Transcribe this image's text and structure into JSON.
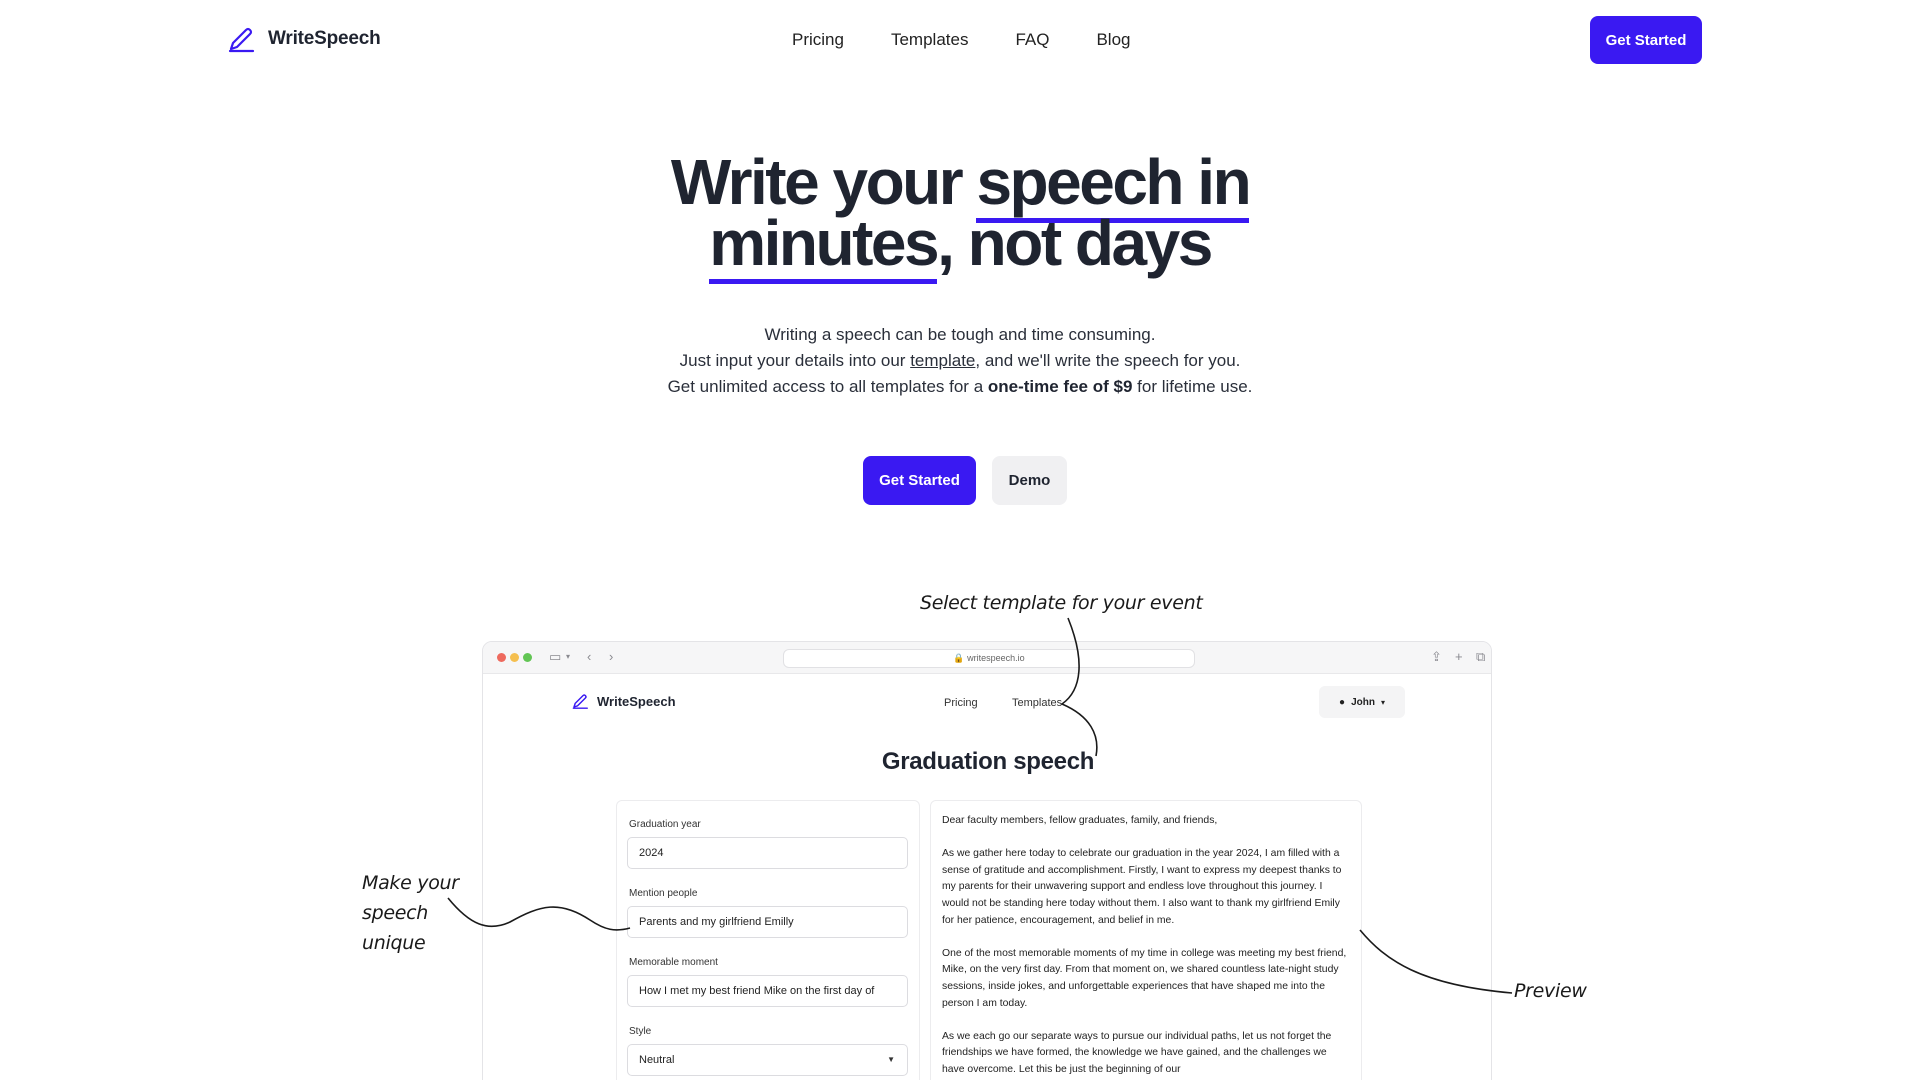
{
  "brand": {
    "name": "WriteSpeech"
  },
  "nav": {
    "links": [
      "Pricing",
      "Templates",
      "FAQ",
      "Blog"
    ],
    "cta": "Get Started"
  },
  "hero": {
    "title_part1": "Write your ",
    "title_highlight1": "speech in",
    "title_highlight2": "minutes",
    "title_part2": ", not days",
    "line1": "Writing a speech can be tough and time consuming.",
    "line2_pre": "Just input your details into our ",
    "line2_link": "template",
    "line2_post": ", and we'll write the speech for you.",
    "line3_pre": "Get unlimited access to all templates for a ",
    "line3_bold": "one-time fee of $9",
    "line3_post": " for lifetime use.",
    "cta": "Get Started",
    "demo": "Demo"
  },
  "annotations": {
    "select": "Select template for your event",
    "unique_1": "Make your",
    "unique_2": "speech",
    "unique_3": "unique",
    "preview": "Preview"
  },
  "mock": {
    "url": "writespeech.io",
    "brand": "WriteSpeech",
    "nav": [
      "Pricing",
      "Templates"
    ],
    "user": "John",
    "title": "Graduation speech",
    "form": {
      "graduation_year_label": "Graduation year",
      "graduation_year_value": "2024",
      "mention_people_label": "Mention people",
      "mention_people_value": "Parents and my girlfriend Emilly",
      "memorable_moment_label": "Memorable moment",
      "memorable_moment_value": "How I met my best friend Mike on the first day of",
      "style_label": "Style",
      "style_value": "Neutral"
    },
    "preview": [
      "Dear faculty members, fellow graduates, family, and friends,",
      "As we gather here today to celebrate our graduation in the year 2024, I am filled with a sense of gratitude and accomplishment. Firstly, I want to express my deepest thanks to my parents for their unwavering support and endless love throughout this journey. I would not be standing here today without them. I also want to thank my girlfriend Emily for her patience, encouragement, and belief in me.",
      "One of the most memorable moments of my time in college was meeting my best friend, Mike, on the very first day. From that moment on, we shared countless late-night study sessions, inside jokes, and unforgettable experiences that have shaped me into the person I am today.",
      "As we each go our separate ways to pursue our individual paths, let us not forget the friendships we have formed, the knowledge we have gained, and the challenges we have overcome. Let this be just the beginning of our"
    ]
  },
  "colors": {
    "accent": "#3a19f2",
    "text": "#1f2430"
  }
}
